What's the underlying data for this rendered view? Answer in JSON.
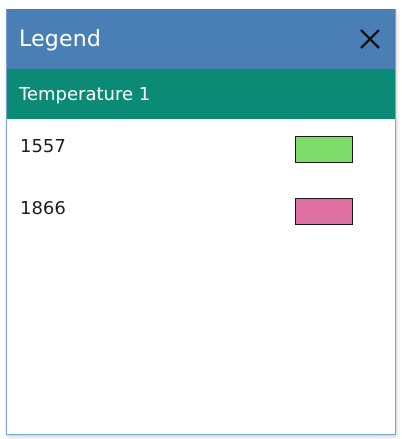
{
  "window": {
    "title": "Legend",
    "close_icon": "close-icon"
  },
  "group": {
    "label": "Temperature 1"
  },
  "items": [
    {
      "label": "1557",
      "color": "#7ddc6a"
    },
    {
      "label": "1866",
      "color": "#de6fa1"
    }
  ],
  "colors": {
    "titlebar": "#4a7fb6",
    "group_header": "#0b8a75"
  }
}
